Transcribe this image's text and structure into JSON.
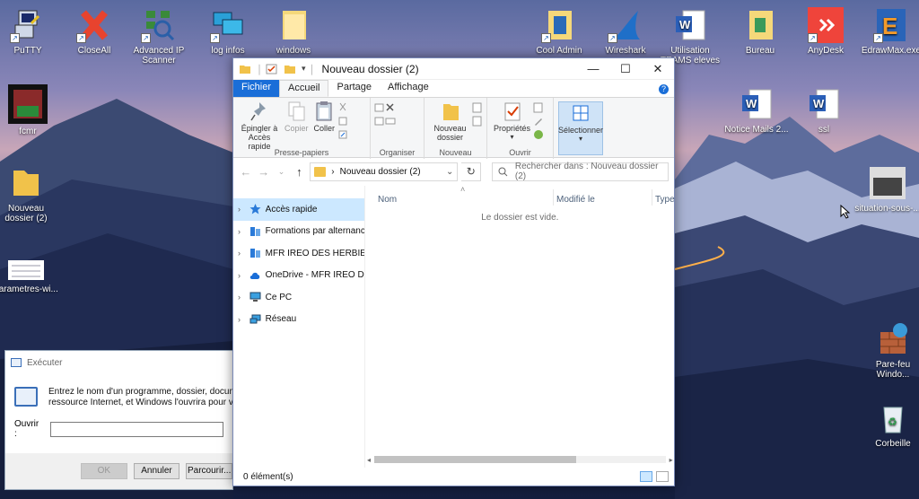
{
  "desktop": {
    "icons": [
      {
        "label": "PuTTY"
      },
      {
        "label": "CloseAll"
      },
      {
        "label": "Advanced IP Scanner"
      },
      {
        "label": "log infos"
      },
      {
        "label": "windows"
      },
      {
        "label": "Cool Admin ma..."
      },
      {
        "label": "Wireshark"
      },
      {
        "label": "Utilisation TEAMS eleves"
      },
      {
        "label": "Bureau"
      },
      {
        "label": "AnyDesk"
      },
      {
        "label": "EdrawMax.exe"
      },
      {
        "label": "fcmr"
      },
      {
        "label": "Nouveau dossier (2)"
      },
      {
        "label": "parametres-wi..."
      },
      {
        "label": "Notice Mails 2..."
      },
      {
        "label": "ssl"
      },
      {
        "label": "situation-sous-..."
      },
      {
        "label": "Pare-feu Windo..."
      },
      {
        "label": "Corbeille"
      }
    ]
  },
  "explorer": {
    "title": "Nouveau dossier (2)",
    "qa_separator": "∣",
    "window_buttons": {
      "minimize": "—",
      "maximize": "☐",
      "close": "✕"
    },
    "tabs": [
      "Fichier",
      "Accueil",
      "Partage",
      "Affichage"
    ],
    "help": "?",
    "ribbon": {
      "pin": "Épingler à Accès rapide",
      "copy": "Copier",
      "paste": "Coller",
      "group_clipboard": "Presse-papiers",
      "group_organize": "Organiser",
      "new_folder": "Nouveau dossier",
      "group_new": "Nouveau",
      "properties": "Propriétés",
      "group_open": "Ouvrir",
      "select": "Sélectionner"
    },
    "address": {
      "back": "←",
      "forward": "→",
      "recent": "⌄",
      "up": "↑",
      "chevron": "›",
      "path": "Nouveau dossier (2)",
      "dropdown": "⌄",
      "refresh": "↻",
      "search_placeholder": "Rechercher dans : Nouveau dossier (2)"
    },
    "nav": [
      {
        "label": "Accès rapide"
      },
      {
        "label": "Formations par alternance e"
      },
      {
        "label": "MFR IREO DES HERBIERS"
      },
      {
        "label": "OneDrive - MFR IREO DES H"
      },
      {
        "label": "Ce PC"
      },
      {
        "label": "Réseau"
      }
    ],
    "nav_chevron": "›",
    "columns": {
      "name": "Nom",
      "modified": "Modifié le",
      "type": "Type",
      "sort": "˄"
    },
    "empty_text": "Le dossier est vide.",
    "scroll_left": "◂",
    "scroll_right": "▸",
    "status": "0 élément(s)",
    "colors": {
      "accent": "#1a6ed8",
      "selected": "#cce8ff",
      "folder": "#f1c24a"
    }
  },
  "run_dialog": {
    "title": "Exécuter",
    "text_line1": "Entrez le nom d'un programme, dossier, document",
    "text_line2": "ressource Internet, et Windows l'ouvrira pour vous.",
    "open_label": "Ouvrir :",
    "ok": "OK",
    "cancel": "Annuler",
    "browse": "Parcourir..."
  }
}
